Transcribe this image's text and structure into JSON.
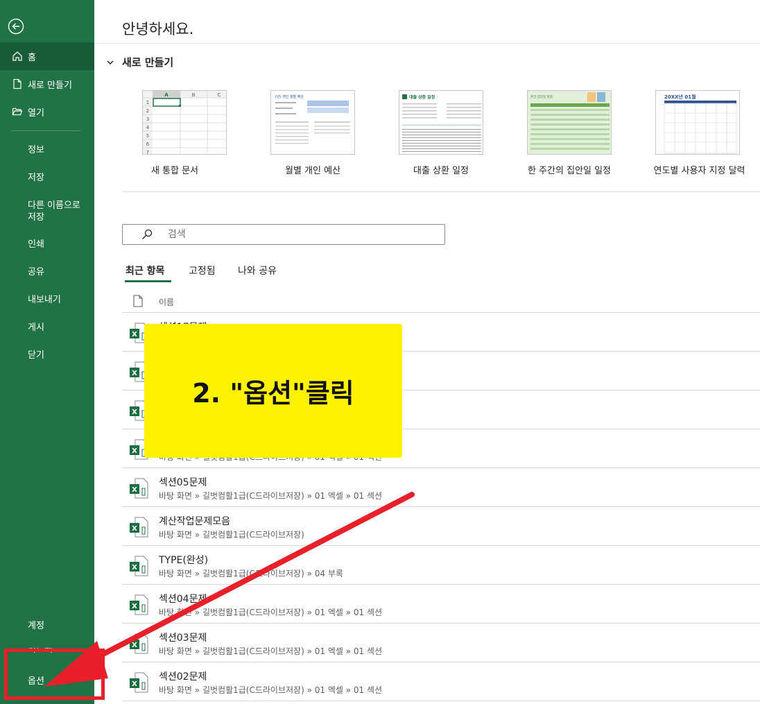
{
  "sidebar": {
    "items": [
      {
        "label": "홈"
      },
      {
        "label": "새로 만들기"
      },
      {
        "label": "열기"
      },
      {
        "label": "정보"
      },
      {
        "label": "저장"
      },
      {
        "label_line1": "다른 이름으로",
        "label_line2": "저장"
      },
      {
        "label": "인쇄"
      },
      {
        "label": "공유"
      },
      {
        "label": "내보내기"
      },
      {
        "label": "게시"
      },
      {
        "label": "닫기"
      }
    ],
    "bottom": [
      {
        "label": "계정"
      },
      {
        "label": "피드백"
      },
      {
        "label": "옵션"
      }
    ]
  },
  "greeting": "안녕하세요.",
  "new_section": {
    "title": "새로 만들기",
    "templates": [
      {
        "label": "새 통합 문서",
        "cols": [
          "A",
          "B",
          "C"
        ],
        "rows": [
          "1",
          "2",
          "3",
          "4",
          "5",
          "6",
          "7"
        ]
      },
      {
        "label": "월별 개인 예산",
        "preview_title": "(년) 개인 월별 예산"
      },
      {
        "label": "대출 상환 일정",
        "preview_title": "대출 상환 일정"
      },
      {
        "label": "한 주간의 집안일 일정",
        "preview_title": "주간 집안일 일정"
      },
      {
        "label": "연도별 사용자 지정 달력",
        "preview_title": "20XX년 01월"
      }
    ]
  },
  "search": {
    "placeholder": "검색"
  },
  "tabs": [
    {
      "label": "최근 항목"
    },
    {
      "label": "고정됨"
    },
    {
      "label": "나와 공유"
    }
  ],
  "list": {
    "header_name": "이름",
    "files": [
      {
        "name": "섹션17문제",
        "path": ""
      },
      {
        "name": "",
        "path": ""
      },
      {
        "name": "",
        "path": ""
      },
      {
        "name": "",
        "path": "바탕 화면 » 길벗컴활1급(C드라이브저장) » 01 엑셀 » 01 섹션"
      },
      {
        "name": "섹션05문제",
        "path": "바탕 화면 » 길벗컴활1급(C드라이브저장) » 01 엑셀 » 01 섹션"
      },
      {
        "name": "계산작업문제모음",
        "path": "바탕 화면 » 길벗컴활1급(C드라이브저장)"
      },
      {
        "name": "TYPE(완성)",
        "path": "바탕 화면 » 길벗컴활1급(C드라이브저장) » 04 부록"
      },
      {
        "name": "섹션04문제",
        "path": "바탕 화면 » 길벗컴활1급(C드라이브저장) » 01 엑셀 » 01 섹션"
      },
      {
        "name": "섹션03문제",
        "path": "바탕 화면 » 길벗컴활1급(C드라이브저장) » 01 엑셀 » 01 섹션"
      },
      {
        "name": "섹션02문제",
        "path": "바탕 화면 » 길벗컴활1급(C드라이브저장) » 01 엑셀 » 01 섹션"
      }
    ]
  },
  "callout": {
    "text": "2. \"옵션\"클릭"
  },
  "colors": {
    "sidebar": "#217346",
    "active": "#185c37",
    "callout": "#fff200",
    "highlight": "#e8202a"
  }
}
